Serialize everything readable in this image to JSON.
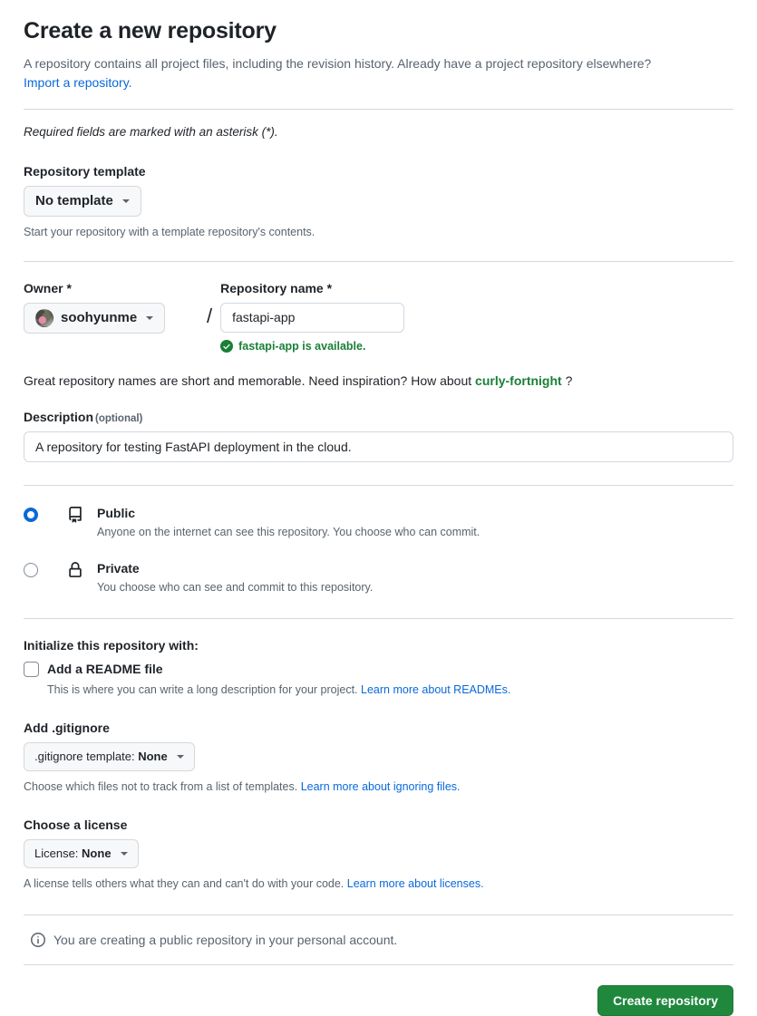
{
  "header": {
    "title": "Create a new repository",
    "subtitle": "A repository contains all project files, including the revision history. Already have a project repository elsewhere?",
    "import_link": "Import a repository.",
    "required_note": "Required fields are marked with an asterisk (*)."
  },
  "template": {
    "label": "Repository template",
    "selected": "No template",
    "hint": "Start your repository with a template repository's contents."
  },
  "owner": {
    "label": "Owner *",
    "name": "soohyunme",
    "separator": "/"
  },
  "repo_name": {
    "label": "Repository name *",
    "value": "fastapi-app",
    "placeholder": "",
    "availability": "fastapi-app is available."
  },
  "inspiration": {
    "prefix": "Great repository names are short and memorable. Need inspiration? How about",
    "suggestion": "curly-fortnight",
    "suffix": "?"
  },
  "description": {
    "label": "Description",
    "optional": "(optional)",
    "value": "A repository for testing FastAPI deployment in the cloud.",
    "placeholder": ""
  },
  "visibility": {
    "options": [
      {
        "title": "Public",
        "description": "Anyone on the internet can see this repository. You choose who can commit.",
        "icon": "repo-icon",
        "selected": true
      },
      {
        "title": "Private",
        "description": "You choose who can see and commit to this repository.",
        "icon": "lock-icon",
        "selected": false
      }
    ]
  },
  "initialize": {
    "title": "Initialize this repository with:",
    "readme_label": "Add a README file",
    "readme_checked": false,
    "readme_hint": "This is where you can write a long description for your project.",
    "readme_link": "Learn more about READMEs."
  },
  "gitignore": {
    "label": "Add .gitignore",
    "selected_prefix": ".gitignore template:",
    "selected_value": "None",
    "hint": "Choose which files not to track from a list of templates.",
    "link": "Learn more about ignoring files."
  },
  "license": {
    "label": "Choose a license",
    "selected_prefix": "License:",
    "selected_value": "None",
    "hint": "A license tells others what they can and can't do with your code.",
    "link": "Learn more about licenses."
  },
  "footer": {
    "note": "You are creating a public repository in your personal account.",
    "submit_label": "Create repository"
  },
  "colors": {
    "accent": "#0969da",
    "success": "#1a7f37",
    "primary_button": "#1f883d",
    "border": "#d1d9e0",
    "muted_text": "#59636e"
  }
}
